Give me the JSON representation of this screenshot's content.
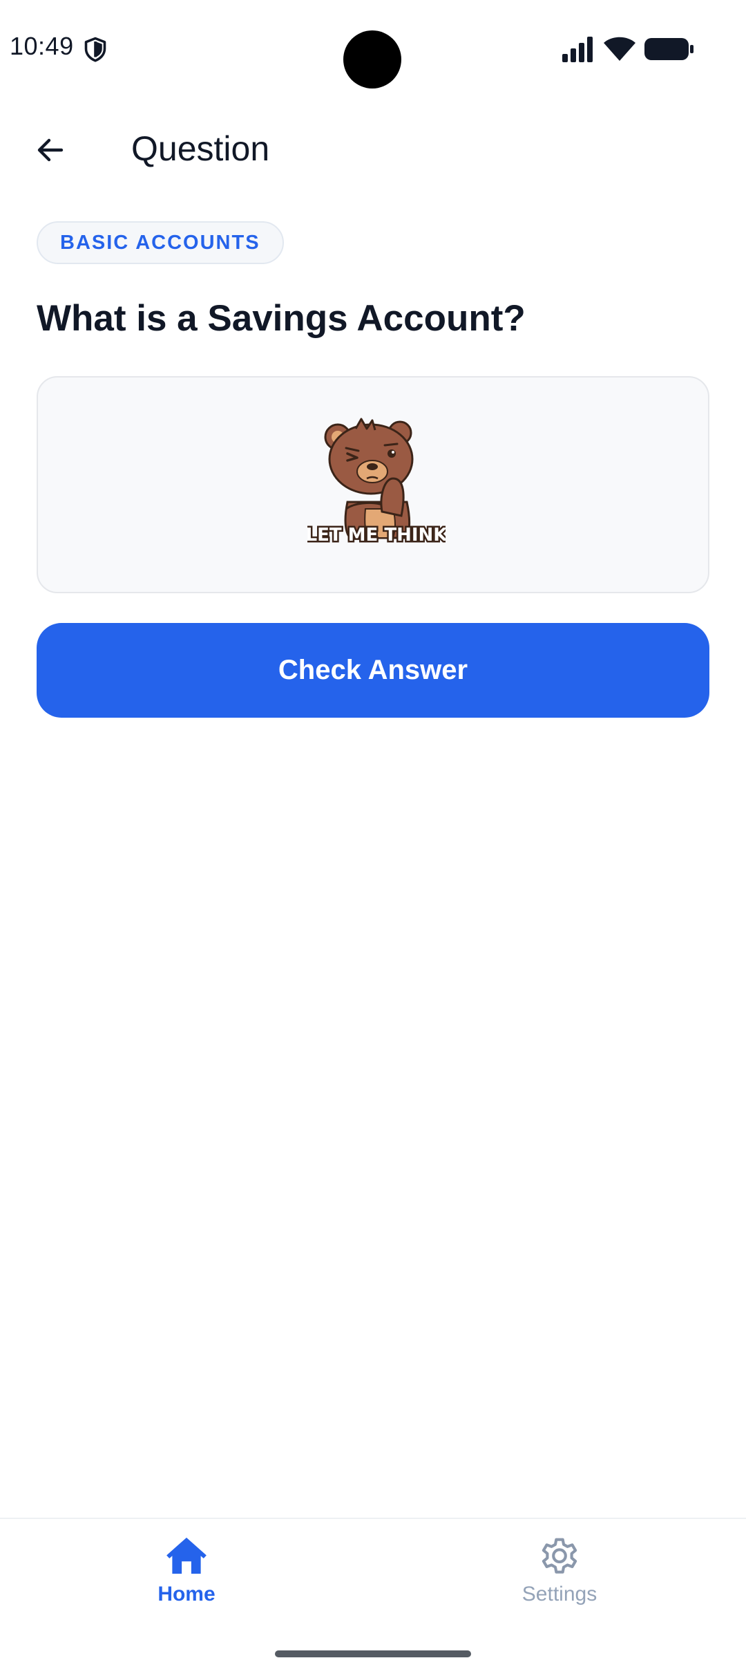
{
  "status_bar": {
    "time": "10:49",
    "icons": [
      "shield-icon",
      "signal-icon",
      "wifi-icon",
      "battery-icon"
    ]
  },
  "app_bar": {
    "title": "Question",
    "back_icon": "arrow-left-icon"
  },
  "question": {
    "category": "BASIC ACCOUNTS",
    "text": "What is a Savings Account?",
    "illustration": {
      "name": "thinking-bear",
      "caption": "LET ME THINK"
    }
  },
  "actions": {
    "check_answer_label": "Check Answer"
  },
  "bottom_nav": {
    "items": [
      {
        "label": "Home",
        "icon": "home-icon",
        "active": true
      },
      {
        "label": "Settings",
        "icon": "gear-icon",
        "active": false
      }
    ]
  },
  "colors": {
    "accent": "#2563eb",
    "text_primary": "#111827",
    "inactive": "#94a3b8",
    "card_bg": "#f8f9fb"
  }
}
